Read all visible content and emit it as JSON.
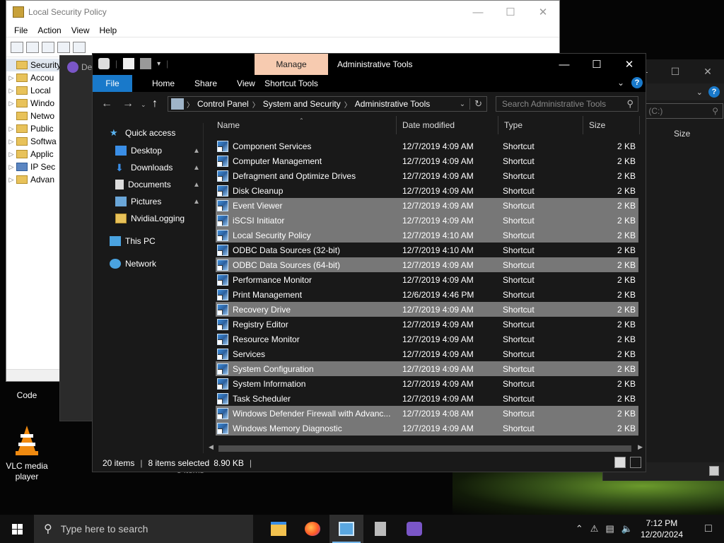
{
  "lsp_window": {
    "title": "Local Security Policy",
    "menu": [
      "File",
      "Action",
      "View",
      "Help"
    ],
    "tree": [
      "Security S",
      "Accou",
      "Local",
      "Windo",
      "Netwo",
      "Public",
      "Softwa",
      "Applic",
      "IP Sec",
      "Advan"
    ],
    "caption_min": "—",
    "caption_max": "☐",
    "caption_close": "✕"
  },
  "behind_window_title": "De",
  "desktop_icons": [
    {
      "label": "Code",
      "icon": "vscode-icon"
    },
    {
      "label": "VLC media player",
      "icon": "vlc-cone-icon"
    }
  ],
  "bg_explorer": {
    "search_partial": "k (C:)",
    "size_header": "Size",
    "status_partial": "5 items"
  },
  "explorer": {
    "title": "Administrative Tools",
    "contextual_tab": "Manage",
    "ribbon_tabs": [
      "File",
      "Home",
      "Share",
      "View"
    ],
    "contextual_ribbon_tab": "Shortcut Tools",
    "breadcrumb": [
      "Control Panel",
      "System and Security",
      "Administrative Tools"
    ],
    "search_placeholder": "Search Administrative Tools",
    "columns": {
      "name": "Name",
      "date": "Date modified",
      "type": "Type",
      "size": "Size"
    },
    "nav": {
      "quick_access": "Quick access",
      "desktop": "Desktop",
      "downloads": "Downloads",
      "documents": "Documents",
      "pictures": "Pictures",
      "nvidia": "NvidiaLogging",
      "this_pc": "This PC",
      "network": "Network"
    },
    "files": [
      {
        "name": "Component Services",
        "date": "12/7/2019 4:09 AM",
        "type": "Shortcut",
        "size": "2 KB",
        "selected": false
      },
      {
        "name": "Computer Management",
        "date": "12/7/2019 4:09 AM",
        "type": "Shortcut",
        "size": "2 KB",
        "selected": false
      },
      {
        "name": "Defragment and Optimize Drives",
        "date": "12/7/2019 4:09 AM",
        "type": "Shortcut",
        "size": "2 KB",
        "selected": false
      },
      {
        "name": "Disk Cleanup",
        "date": "12/7/2019 4:09 AM",
        "type": "Shortcut",
        "size": "2 KB",
        "selected": false
      },
      {
        "name": "Event Viewer",
        "date": "12/7/2019 4:09 AM",
        "type": "Shortcut",
        "size": "2 KB",
        "selected": true
      },
      {
        "name": "iSCSI Initiator",
        "date": "12/7/2019 4:09 AM",
        "type": "Shortcut",
        "size": "2 KB",
        "selected": true
      },
      {
        "name": "Local Security Policy",
        "date": "12/7/2019 4:10 AM",
        "type": "Shortcut",
        "size": "2 KB",
        "selected": true
      },
      {
        "name": "ODBC Data Sources (32-bit)",
        "date": "12/7/2019 4:10 AM",
        "type": "Shortcut",
        "size": "2 KB",
        "selected": false
      },
      {
        "name": "ODBC Data Sources (64-bit)",
        "date": "12/7/2019 4:09 AM",
        "type": "Shortcut",
        "size": "2 KB",
        "selected": true
      },
      {
        "name": "Performance Monitor",
        "date": "12/7/2019 4:09 AM",
        "type": "Shortcut",
        "size": "2 KB",
        "selected": false
      },
      {
        "name": "Print Management",
        "date": "12/6/2019 4:46 PM",
        "type": "Shortcut",
        "size": "2 KB",
        "selected": false
      },
      {
        "name": "Recovery Drive",
        "date": "12/7/2019 4:09 AM",
        "type": "Shortcut",
        "size": "2 KB",
        "selected": true
      },
      {
        "name": "Registry Editor",
        "date": "12/7/2019 4:09 AM",
        "type": "Shortcut",
        "size": "2 KB",
        "selected": false
      },
      {
        "name": "Resource Monitor",
        "date": "12/7/2019 4:09 AM",
        "type": "Shortcut",
        "size": "2 KB",
        "selected": false
      },
      {
        "name": "Services",
        "date": "12/7/2019 4:09 AM",
        "type": "Shortcut",
        "size": "2 KB",
        "selected": false
      },
      {
        "name": "System Configuration",
        "date": "12/7/2019 4:09 AM",
        "type": "Shortcut",
        "size": "2 KB",
        "selected": true
      },
      {
        "name": "System Information",
        "date": "12/7/2019 4:09 AM",
        "type": "Shortcut",
        "size": "2 KB",
        "selected": false
      },
      {
        "name": "Task Scheduler",
        "date": "12/7/2019 4:09 AM",
        "type": "Shortcut",
        "size": "2 KB",
        "selected": false
      },
      {
        "name": "Windows Defender Firewall with Advanc...",
        "date": "12/7/2019 4:08 AM",
        "type": "Shortcut",
        "size": "2 KB",
        "selected": true
      },
      {
        "name": "Windows Memory Diagnostic",
        "date": "12/7/2019 4:09 AM",
        "type": "Shortcut",
        "size": "2 KB",
        "selected": true
      }
    ],
    "status": {
      "count": "20 items",
      "selected": "8 items selected",
      "size": "8.90 KB"
    }
  },
  "taskbar": {
    "search_placeholder": "Type here to search",
    "apps": [
      "file-explorer-icon",
      "firefox-icon",
      "control-panel-icon",
      "server-manager-icon",
      "protonvpn-icon"
    ],
    "time": "7:12 PM",
    "date": "12/20/2024"
  },
  "colors": {
    "file_tab": "#1979ca",
    "manage_tab": "#f7cbb0",
    "selection": "#777777",
    "accent": "#76b9ed"
  }
}
